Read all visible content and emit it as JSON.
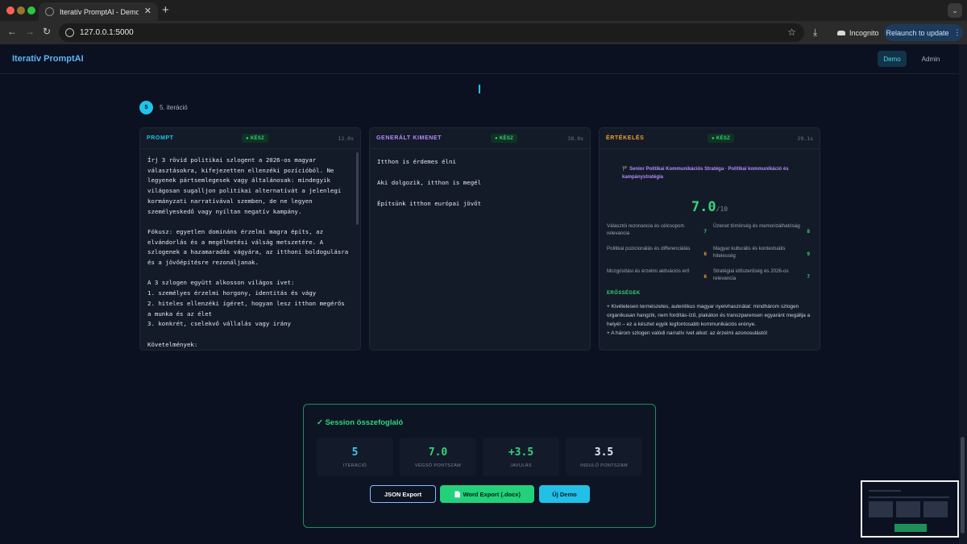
{
  "browser": {
    "tab_title": "Iteratív PromptAI - Demo",
    "tab_close": "✕",
    "new_tab": "+",
    "url": "127.0.0.1:5000",
    "incognito_label": "Incognito",
    "relaunch_label": "Relaunch to update",
    "relaunch_menu": "⋮",
    "back_glyph": "←",
    "forward_glyph": "→",
    "reload_glyph": "↻",
    "star_glyph": "☆",
    "download_glyph": "⤓",
    "tab_menu_glyph": "⌄"
  },
  "app": {
    "brand": "Iteratív PromptAI",
    "nav": {
      "demo": "Demo",
      "admin": "Admin"
    }
  },
  "iteration": {
    "number": "5",
    "label": "5. iteráció",
    "status_label": "● KÉSZ",
    "prompt": {
      "title": "PROMPT",
      "time": "12.0s",
      "text": "Írj 3 rövid politikai szlogent a 2026-os magyar\nválasztásokra, kifejezetten ellenzéki pozícióból. Ne\nlegyenek pártsemlegesek vagy általánosak: mindegyik\nvilágosan sugalljon politikai alternatívát a jelenlegi\nkormányzati narratívával szemben, de ne legyen\nszemélyeskedő vagy nyíltan negatív kampány.\n\nFókusz: egyetlen domináns érzelmi magra építs, az\nelvándorlás és a megélhetési válság metszetére. A\nszlogenek a hazamaradás vágyára, az itthoni boldogulásra\nés a jövőépítésre rezonáljanak.\n\nA 3 szlogen együtt alkosson világos ívet:\n1. személyes érzelmi horgony, identitás és vágy\n2. hiteles ellenzéki ígéret, hogyan lesz itthon megérős\na munka és az élet\n3. konkrét, cselekvő vállalás vagy irány\n\nKövetelmények:"
    },
    "output": {
      "title": "GENERÁLT KIMENET",
      "time": "38.9s",
      "text": "Itthon is érdemes élni\n\nAki dolgozik, itthon is megél\n\nÉpítsünk itthon európai jövőt"
    },
    "evaluation": {
      "title": "ÉRTÉKELÉS",
      "time": "29.1s",
      "role": "🏴 Senior Politikai Kommunikációs Stratéga · Politikai kommunikáció és kampánystratégia",
      "score": "7.0",
      "score_max": "/10",
      "criteria": [
        {
          "label": "Választói rezonancia és célcsoport-relevancia",
          "value": "7",
          "color": "#34d47a"
        },
        {
          "label": "Üzenet tömörség és memorizálhatóság",
          "value": "8",
          "color": "#34d47a"
        },
        {
          "label": "Politikai pozicionálás és differenciálás",
          "value": "6",
          "color": "#f0a030"
        },
        {
          "label": "Magyar kulturális és kontextuális hitelesség",
          "value": "9",
          "color": "#34d47a"
        },
        {
          "label": "Mozgósítási és érzelmi aktivációs erő",
          "value": "6",
          "color": "#f0a030"
        },
        {
          "label": "Stratégiai időszerűség és 2026-os relevancia",
          "value": "7",
          "color": "#34d47a"
        }
      ],
      "strengths_title": "ERŐSSÉGEK",
      "strengths_text": "+ Kivételesen természetes, autentikus magyar nyelvhasználat: mindhárom szlogen organikusan hangzik, nem fordítás-ízű, plakáton és transzparensen egyaránt megállja a helyét – ez a készlet egyik legfontosabb kommunikációs erénye.\n+ A három szlogen valódi narratív ívet alkot: az érzelmi azonosulástól"
    }
  },
  "summary": {
    "title": "✓ Session összefoglaló",
    "stats": [
      {
        "value": "5",
        "label": "ITERÁCIÓ",
        "color": "#3fc8f0"
      },
      {
        "value": "7.0",
        "label": "VÉGSŐ PONTSZÁM",
        "color": "#34d47a"
      },
      {
        "value": "+3.5",
        "label": "JAVULÁS",
        "color": "#34d47a"
      },
      {
        "value": "3.5",
        "label": "INDULÓ PONTSZÁM",
        "color": "#e8ecf2"
      }
    ],
    "buttons": {
      "json": "JSON Export",
      "word": "📄 Word Export (.docx)",
      "new": "Új Demo"
    }
  }
}
